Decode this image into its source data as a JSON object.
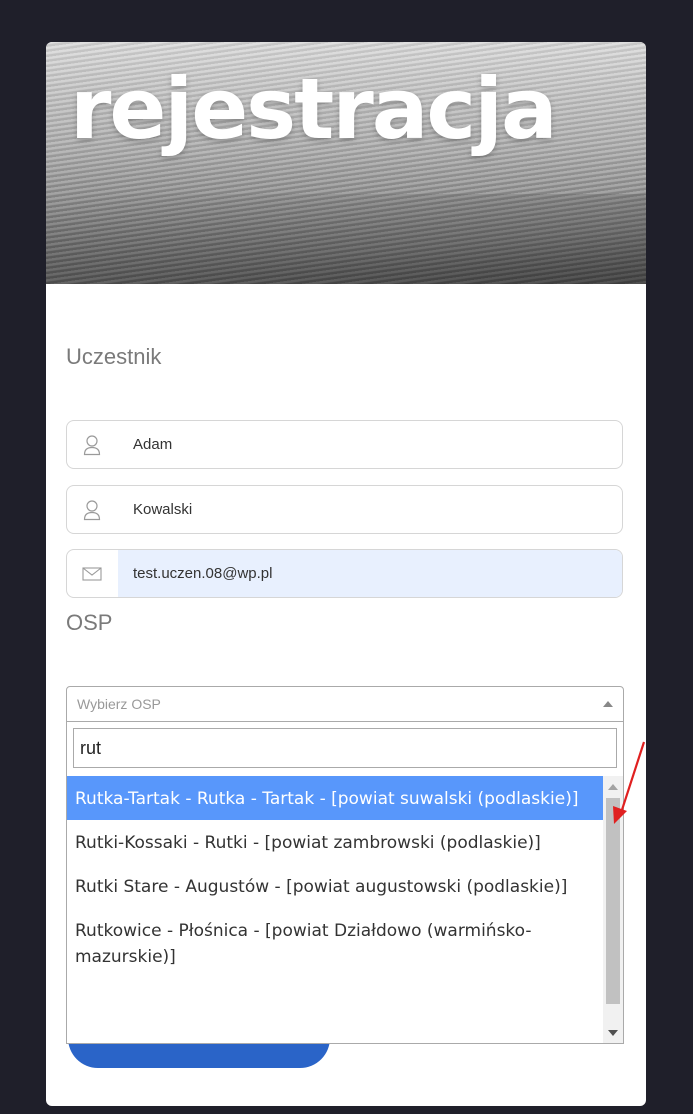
{
  "header": {
    "title": "rejestracja"
  },
  "participant": {
    "section_label": "Uczestnik",
    "first_name": "Adam",
    "last_name": "Kowalski",
    "email": "test.uczen.08@wp.pl",
    "icons": [
      "user-icon",
      "user-icon",
      "envelope-icon"
    ]
  },
  "osp": {
    "section_label": "OSP",
    "select_placeholder": "Wybierz OSP",
    "search_value": "rut",
    "options": [
      {
        "label": "Rutka-Tartak - Rutka - Tartak - [powiat suwalski (podlaskie)]",
        "highlighted": true
      },
      {
        "label": "Rutki-Kossaki - Rutki - [powiat zambrowski (podlaskie)]",
        "highlighted": false
      },
      {
        "label": "Rutki Stare - Augustów - [powiat augustowski (podlaskie)]",
        "highlighted": false
      },
      {
        "label": "Rutkowice - Płośnica - [powiat Działdowo (warmińsko-mazurskie)]",
        "highlighted": false
      }
    ]
  },
  "colors": {
    "highlight": "#5897fb",
    "submit_button": "#2a64c8",
    "autofill": "#e8f0fe",
    "annotation_arrow": "#e02020"
  }
}
